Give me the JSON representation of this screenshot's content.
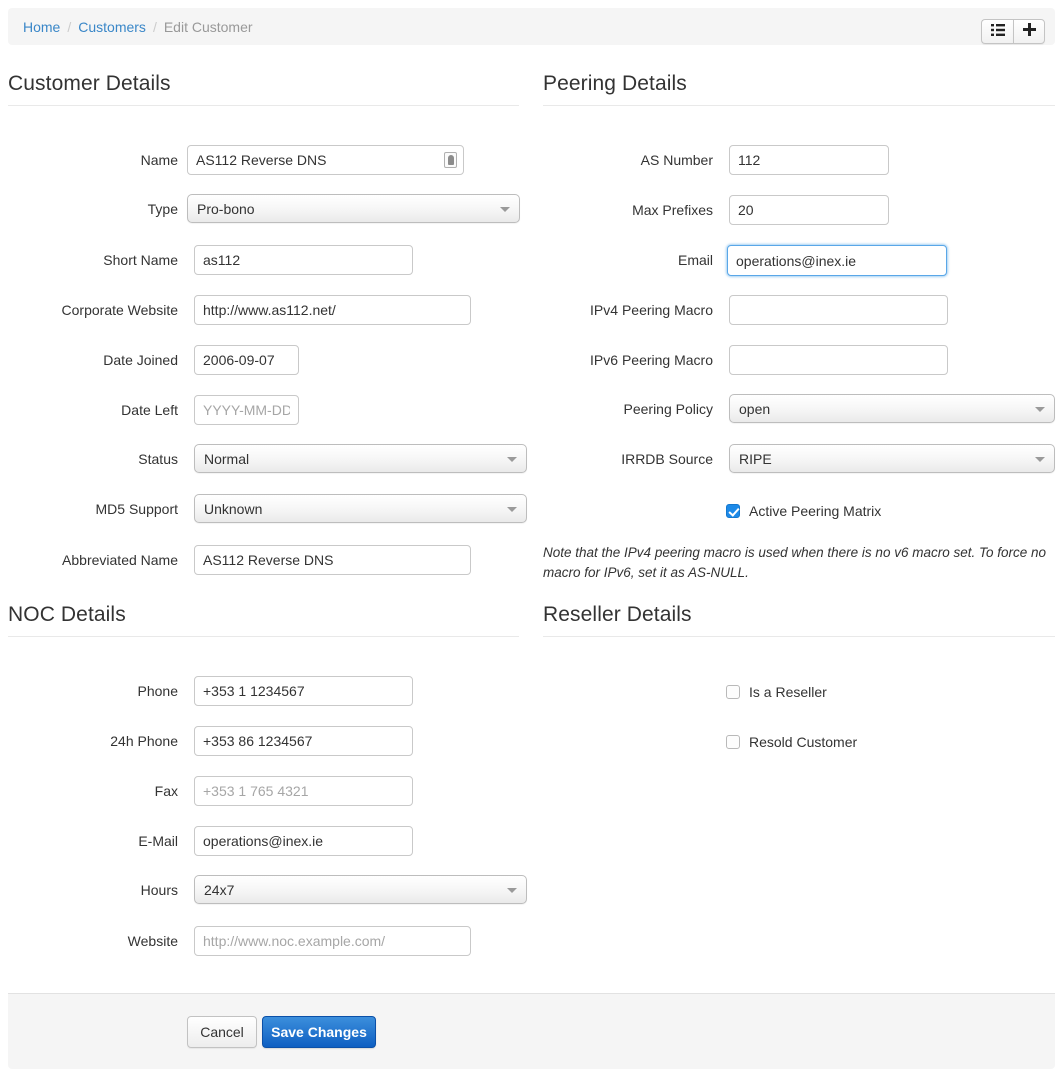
{
  "breadcrumb": {
    "home": "Home",
    "customers": "Customers",
    "current": "Edit Customer",
    "separator": "/"
  },
  "toolbar": {
    "list_icon": "list-icon",
    "add_icon": "plus-icon"
  },
  "sections": {
    "customer_details": "Customer Details",
    "peering_details": "Peering Details",
    "noc_details": "NOC Details",
    "reseller_details": "Reseller Details"
  },
  "customer": {
    "name": {
      "label": "Name",
      "value": "AS112 Reverse DNS",
      "icon": "contact-card-icon"
    },
    "type": {
      "label": "Type",
      "value": "Pro-bono"
    },
    "short_name": {
      "label": "Short Name",
      "value": "as112"
    },
    "corporate_website": {
      "label": "Corporate Website",
      "value": "http://www.as112.net/"
    },
    "date_joined": {
      "label": "Date Joined",
      "value": "2006-09-07"
    },
    "date_left": {
      "label": "Date Left",
      "value": "",
      "placeholder": "YYYY-MM-DD"
    },
    "status": {
      "label": "Status",
      "value": "Normal"
    },
    "md5_support": {
      "label": "MD5 Support",
      "value": "Unknown"
    },
    "abbreviated_name": {
      "label": "Abbreviated Name",
      "value": "AS112 Reverse DNS"
    }
  },
  "peering": {
    "as_number": {
      "label": "AS Number",
      "value": "112"
    },
    "max_prefixes": {
      "label": "Max Prefixes",
      "value": "20"
    },
    "email": {
      "label": "Email",
      "value": "operations@inex.ie",
      "focused": true
    },
    "ipv4_macro": {
      "label": "IPv4 Peering Macro",
      "value": ""
    },
    "ipv6_macro": {
      "label": "IPv6 Peering Macro",
      "value": ""
    },
    "peering_policy": {
      "label": "Peering Policy",
      "value": "open"
    },
    "irrdb_source": {
      "label": "IRRDB Source",
      "value": "RIPE"
    },
    "active_matrix": {
      "label": "Active Peering Matrix",
      "checked": true
    },
    "note": "Note that the IPv4 peering macro is used when there is no v6 macro set. To force no macro for IPv6, set it as AS-NULL."
  },
  "noc": {
    "phone": {
      "label": "Phone",
      "value": "+353 1 1234567"
    },
    "phone24h": {
      "label": "24h Phone",
      "value": "+353 86 1234567"
    },
    "fax": {
      "label": "Fax",
      "value": "",
      "placeholder": "+353 1 765 4321"
    },
    "email": {
      "label": "E-Mail",
      "value": "operations@inex.ie"
    },
    "hours": {
      "label": "Hours",
      "value": "24x7"
    },
    "website": {
      "label": "Website",
      "value": "",
      "placeholder": "http://www.noc.example.com/"
    }
  },
  "reseller": {
    "is_reseller": {
      "label": "Is a Reseller",
      "checked": false
    },
    "resold_customer": {
      "label": "Resold Customer",
      "checked": false
    }
  },
  "footer": {
    "cancel": "Cancel",
    "save": "Save Changes"
  },
  "colors": {
    "link": "#3a87c8",
    "accent": "#1d8ae8",
    "primary_button": "#1069c9",
    "bar_bg": "#f5f5f5"
  }
}
